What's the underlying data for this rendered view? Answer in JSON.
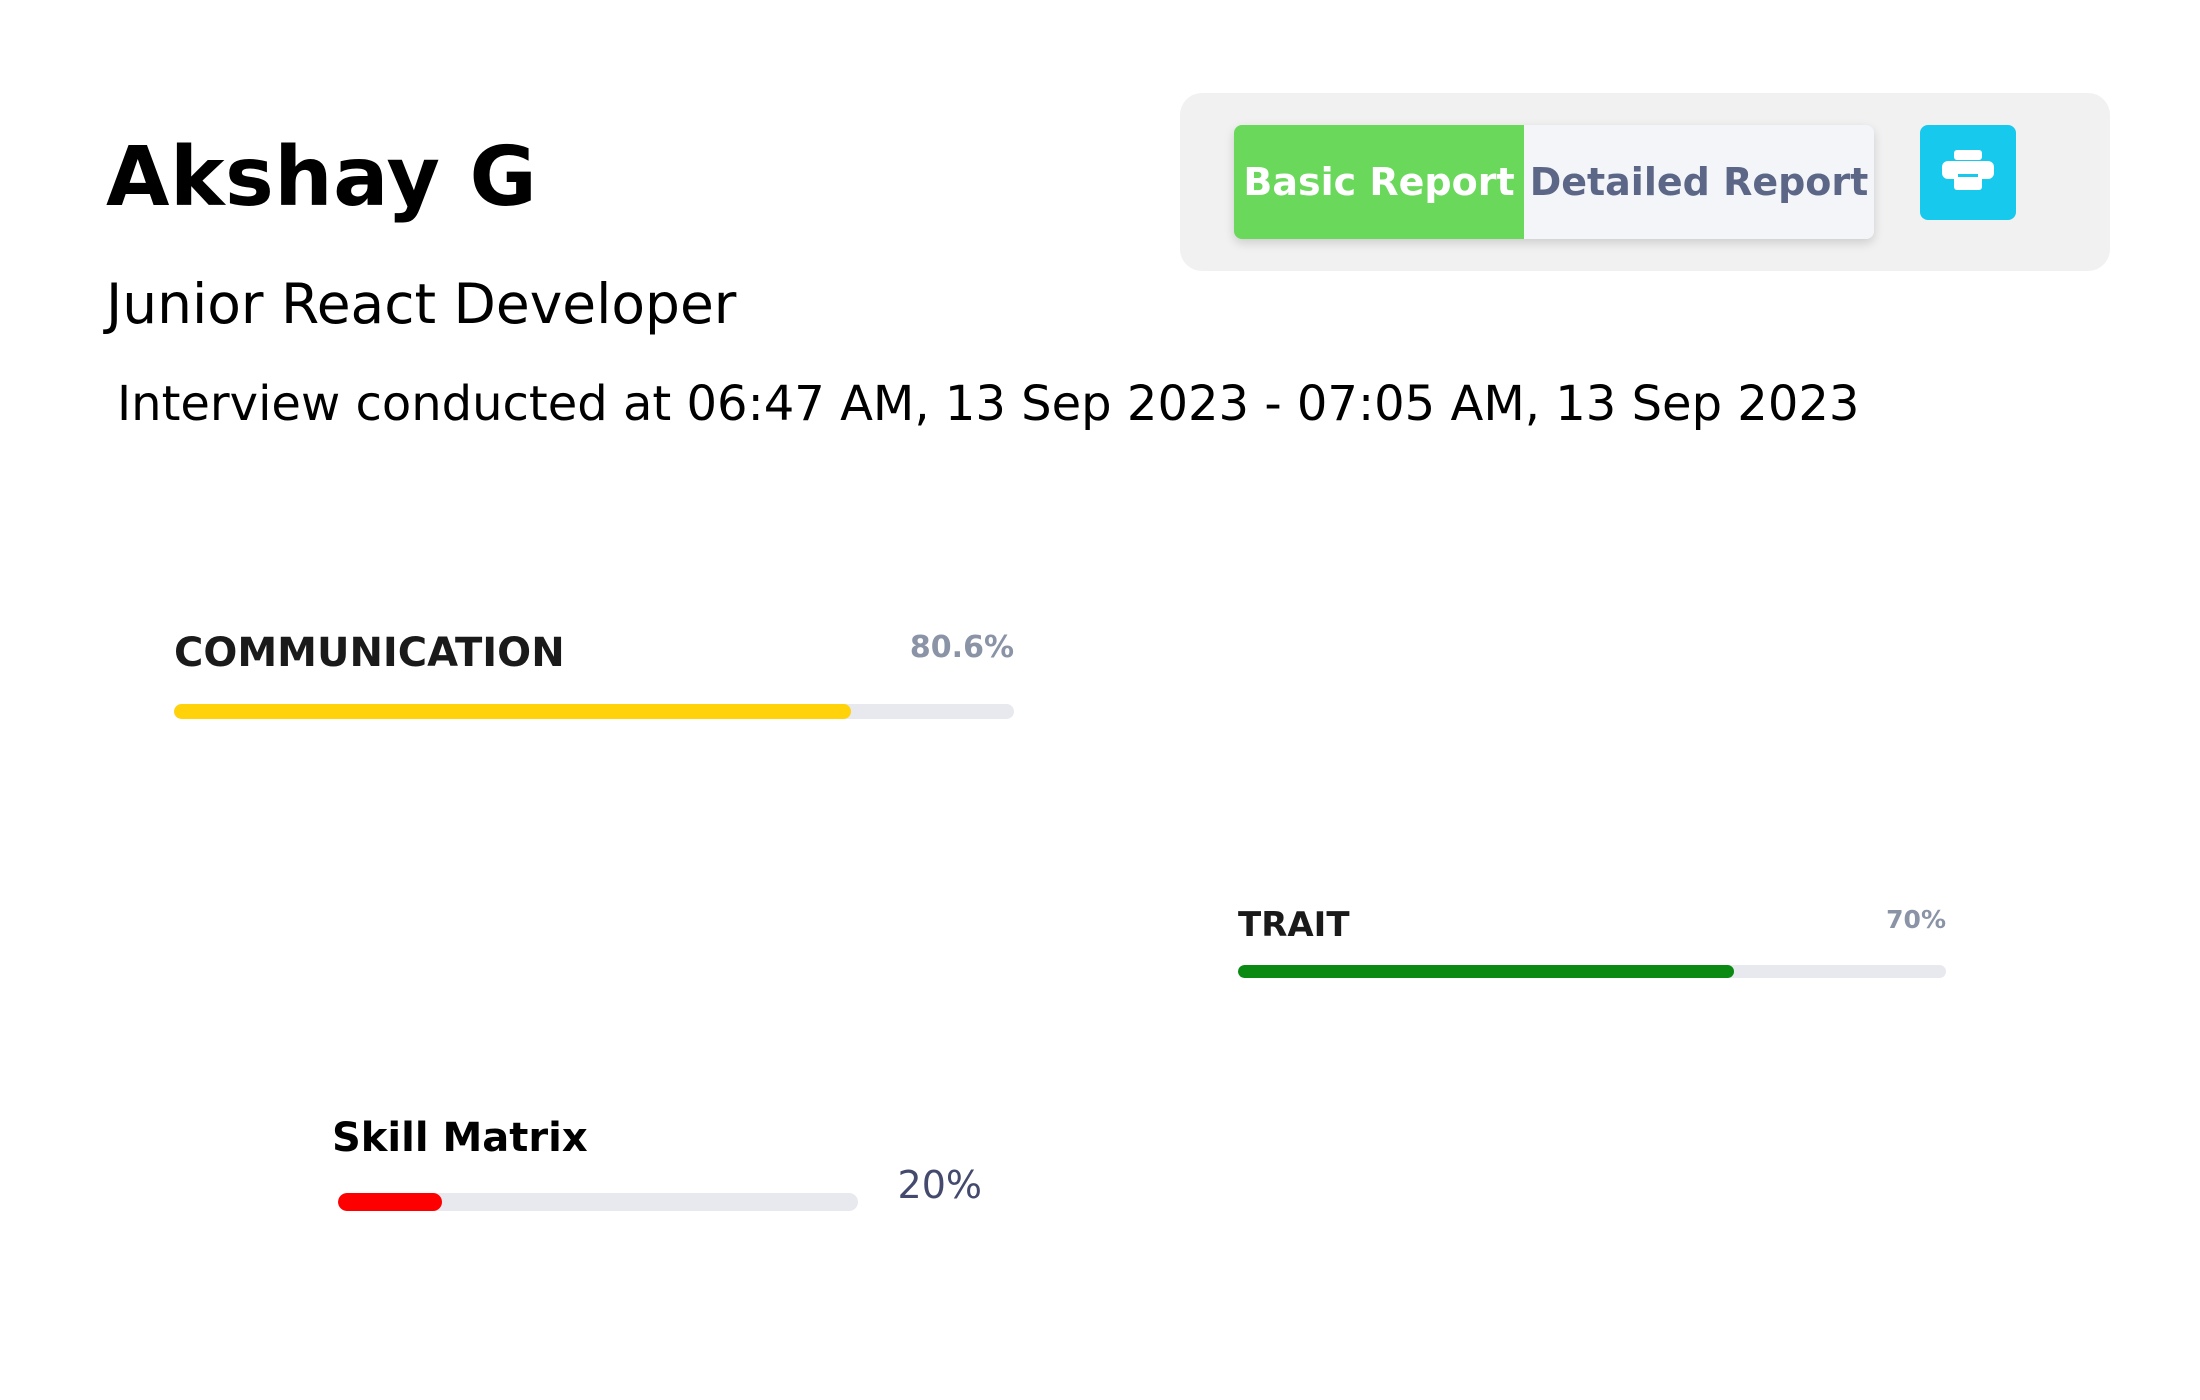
{
  "candidate": {
    "name": "Akshay G",
    "role": "Junior React Developer",
    "interview_time": "Interview conducted at 06:47 AM, 13 Sep 2023 - 07:05 AM, 13 Sep 2023"
  },
  "toolbar": {
    "basic_label": "Basic Report",
    "detailed_label": "Detailed Report",
    "active": "Basic Report",
    "print_icon": "print-icon",
    "colors": {
      "basic": "#69d85b",
      "print": "#18c9ee"
    }
  },
  "metrics": {
    "communication": {
      "label": "COMMUNICATION",
      "percent_text": "80.6%",
      "value": 80.6,
      "color": "#ffd20a"
    },
    "trait": {
      "label": "TRAIT",
      "percent_text": "70%",
      "value": 70,
      "color": "#0a8a12"
    },
    "skill_matrix": {
      "label": "Skill Matrix",
      "percent_text": "20%",
      "value": 20,
      "color": "#ff0000"
    }
  }
}
